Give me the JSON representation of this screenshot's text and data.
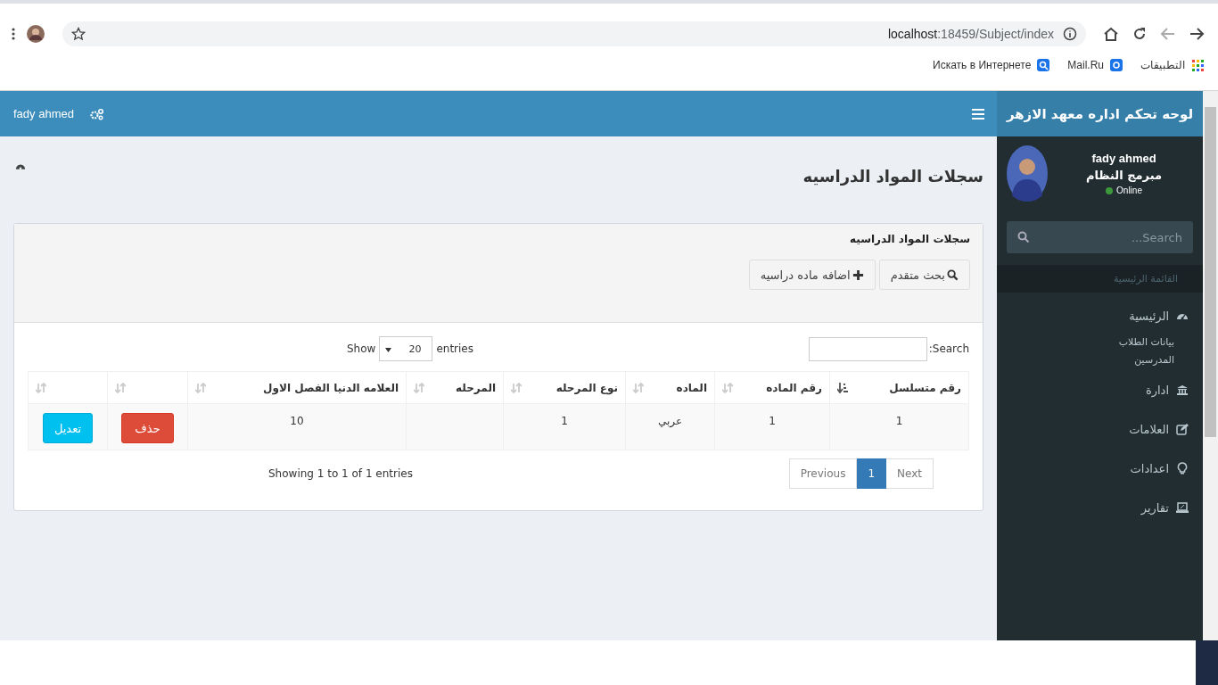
{
  "browser": {
    "address": {
      "host": "localhost",
      "path": ":18459/Subject/index"
    },
    "bookmarks": [
      {
        "kind": "apps",
        "label": "التطبيقات"
      },
      {
        "kind": "mail",
        "label": "Mail.Ru"
      },
      {
        "kind": "search",
        "label": "Искать в Интернете"
      }
    ]
  },
  "header": {
    "logo": "لوحه تحكم اداره معهد الازهر",
    "user_name": "fady ahmed"
  },
  "sidebar": {
    "user": {
      "name": "fady ahmed",
      "role": "مبرمج النظام",
      "status": "Online",
      "online": true
    },
    "search": {
      "placeholder": "Search..."
    },
    "section": "القائمة الرئيسية",
    "items": [
      {
        "kind": "main",
        "label": "الرئيسية"
      },
      {
        "kind": "sub",
        "label": "بيانات الطلاب"
      },
      {
        "kind": "sub",
        "label": "المدرسين"
      },
      {
        "kind": "main",
        "label": "ادارة"
      },
      {
        "kind": "main",
        "label": "العلامات"
      },
      {
        "kind": "main",
        "label": "اعدادات"
      },
      {
        "kind": "main",
        "label": "تقارير"
      }
    ]
  },
  "content": {
    "title": "سجلات المواد الدراسيه",
    "box": {
      "title": "سجلات المواد الدراسيه",
      "buttons": [
        {
          "kind": "search",
          "label": "بحث متقدم"
        },
        {
          "kind": "add",
          "label": "اضافه ماده دراسيه"
        }
      ]
    },
    "table": {
      "search_label": "Search:",
      "show_label": "Show",
      "page_size": "20",
      "entries_label": "entries",
      "columns": [
        {
          "label": "رقم متسلسل",
          "sorted": true
        },
        {
          "label": "رقم الماده",
          "sorted": false
        },
        {
          "label": "الماده",
          "sorted": false
        },
        {
          "label": "نوع المرحله",
          "sorted": false
        },
        {
          "label": "المرحله",
          "sorted": false
        },
        {
          "label": "العلامه الدنيا الفصل الاول",
          "sorted": false
        },
        {
          "sorted": false
        },
        {
          "sorted": false
        }
      ],
      "rows": [
        {
          "cells": [
            "1",
            "1",
            "عربي",
            "1",
            null,
            "10"
          ],
          "actions": [
            {
              "kind": "delete",
              "label": "حذف"
            },
            {
              "kind": "edit",
              "label": "تعديل"
            }
          ]
        }
      ],
      "info": "Showing 1 to 1 of 1 entries",
      "pages": [
        {
          "label": "Next",
          "selected": false
        },
        {
          "label": "1",
          "selected": true
        },
        {
          "label": "Previous",
          "selected": false
        }
      ]
    }
  }
}
